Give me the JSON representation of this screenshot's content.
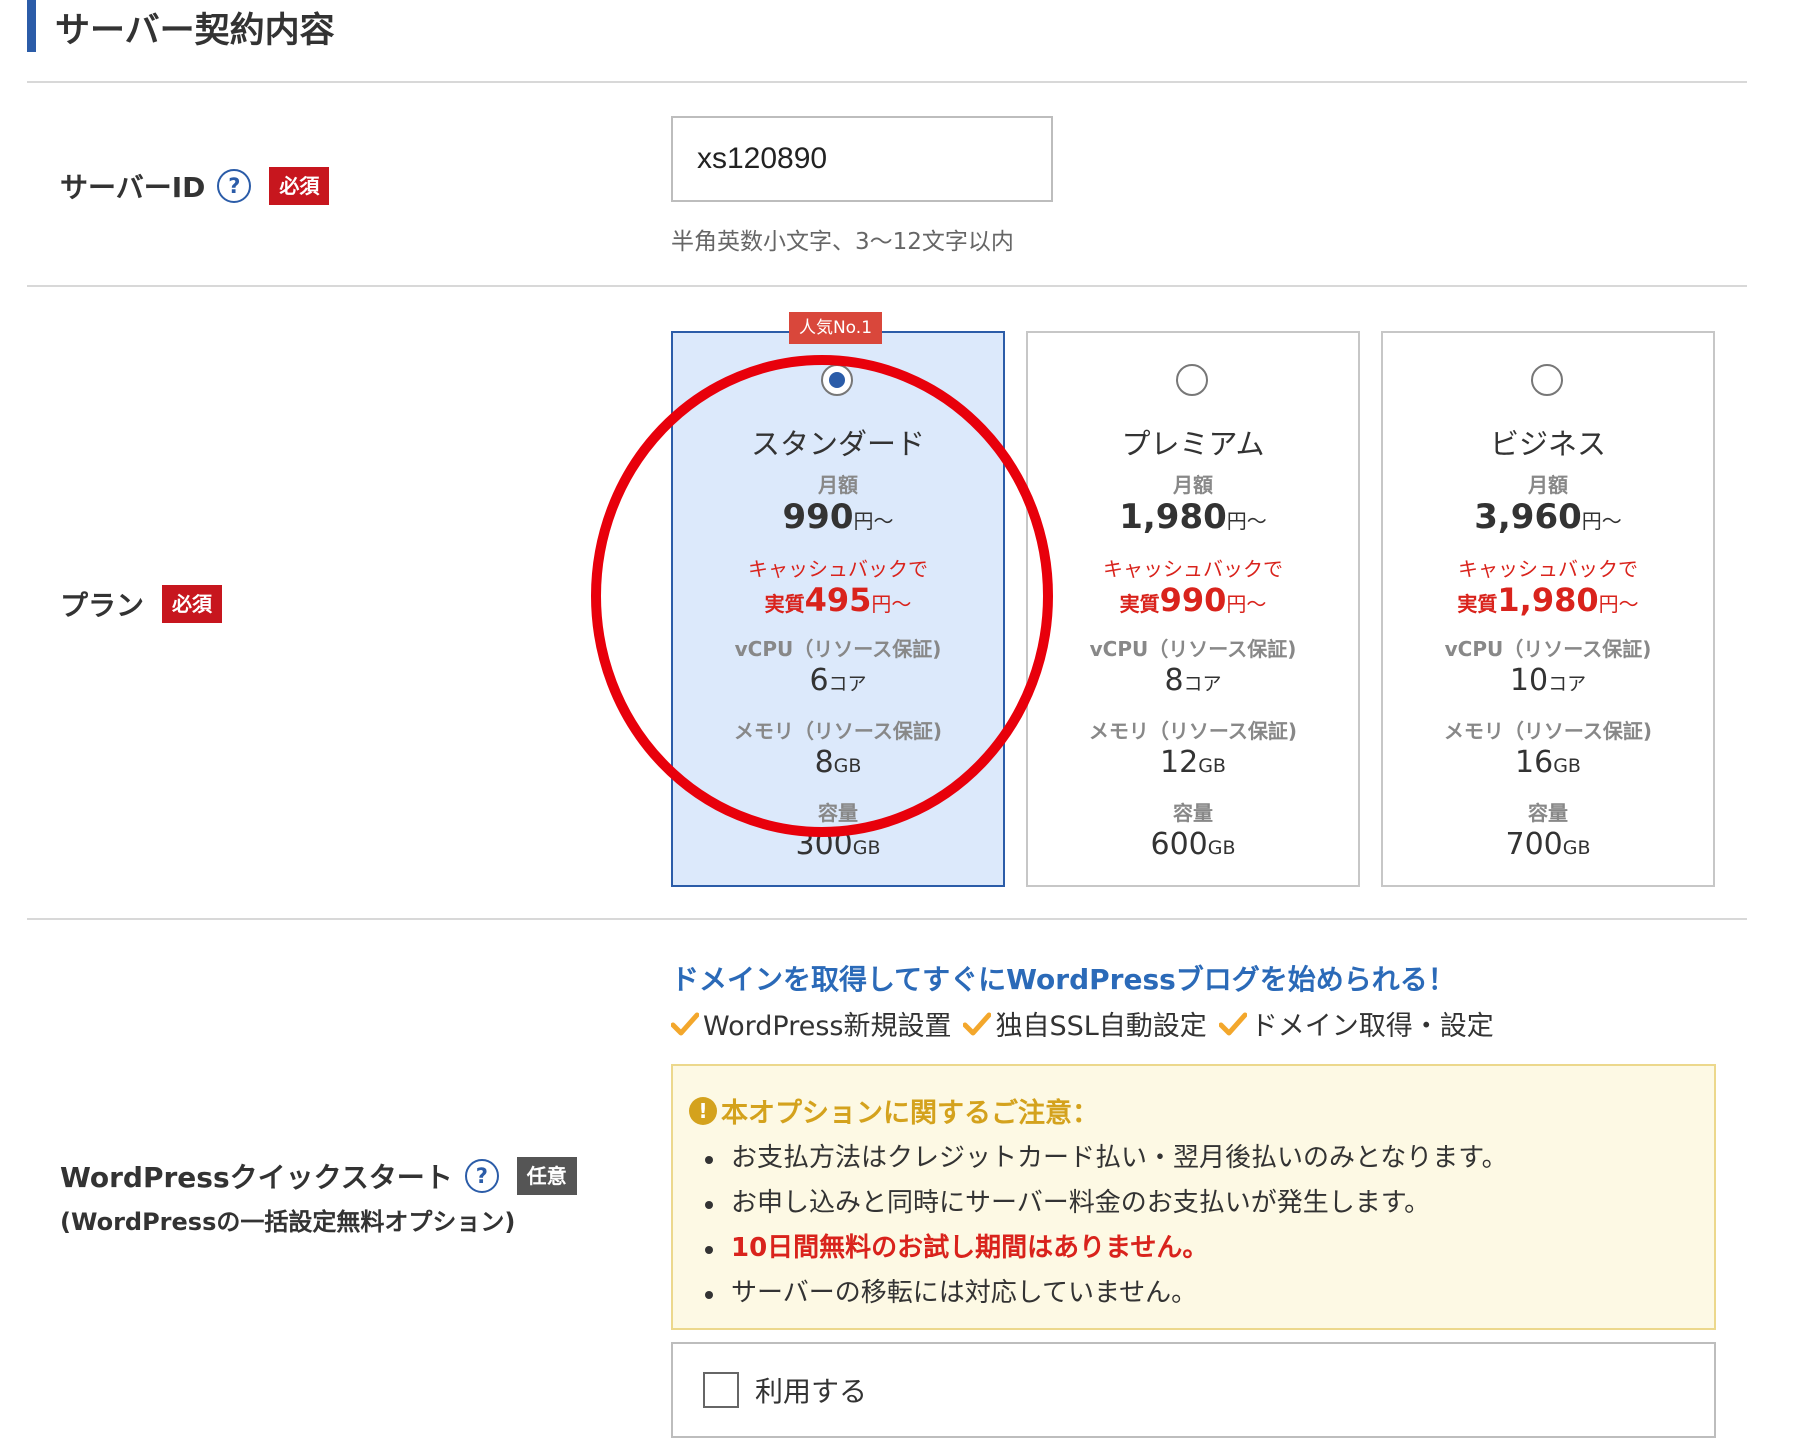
{
  "section": {
    "title": "サーバー契約内容"
  },
  "server_id": {
    "label": "サーバーID",
    "help": "?",
    "required_badge": "必須",
    "value": "xs120890",
    "hint": "半角英数小文字、3〜12文字以内"
  },
  "plan": {
    "label": "プラン",
    "required_badge": "必須",
    "popular_tag": "人気No.1",
    "selected_index": 0,
    "price_label": "月額",
    "cashback_label": "キャッシュバックで",
    "net_prefix": "実質",
    "yen_from": "円〜",
    "vcpu_label": "vCPU（リソース保証)",
    "memory_label": "メモリ（リソース保証)",
    "storage_label": "容量",
    "core_unit": "コア",
    "gb_unit": "GB",
    "cards": [
      {
        "name": "スタンダード",
        "price": "990",
        "net_price": "495",
        "vcpu": "6",
        "memory": "8",
        "storage": "300"
      },
      {
        "name": "プレミアム",
        "price": "1,980",
        "net_price": "990",
        "vcpu": "8",
        "memory": "12",
        "storage": "600"
      },
      {
        "name": "ビジネス",
        "price": "3,960",
        "net_price": "1,980",
        "vcpu": "10",
        "memory": "16",
        "storage": "700"
      }
    ]
  },
  "wordpress": {
    "label": "WordPressクイックスタート",
    "help": "?",
    "optional_badge": "任意",
    "sub_label": "(WordPressの一括設定無料オプション)",
    "title": "ドメインを取得してすぐにWordPressブログを始められる！",
    "features": [
      "WordPress新規設置",
      "独自SSL自動設定",
      "ドメイン取得・設定"
    ],
    "notice": {
      "icon": "!",
      "title": "本オプションに関するご注意：",
      "items": [
        "お支払方法はクレジットカード払い・翌月後払いのみとなります。",
        "お申し込みと同時にサーバー料金のお支払いが発生します。",
        "10日間無料のお試し期間はありません。",
        "サーバーの移転には対応していません。"
      ]
    },
    "use_label": "利用する",
    "use_checked": false
  },
  "colors": {
    "accent_blue": "#2b5ca8",
    "required_red": "#c7161e",
    "selected_bg": "#dce9fb",
    "annotation_red": "#e8000b",
    "notice_bg": "#fdf9e4",
    "check_orange": "#f3a72c"
  }
}
